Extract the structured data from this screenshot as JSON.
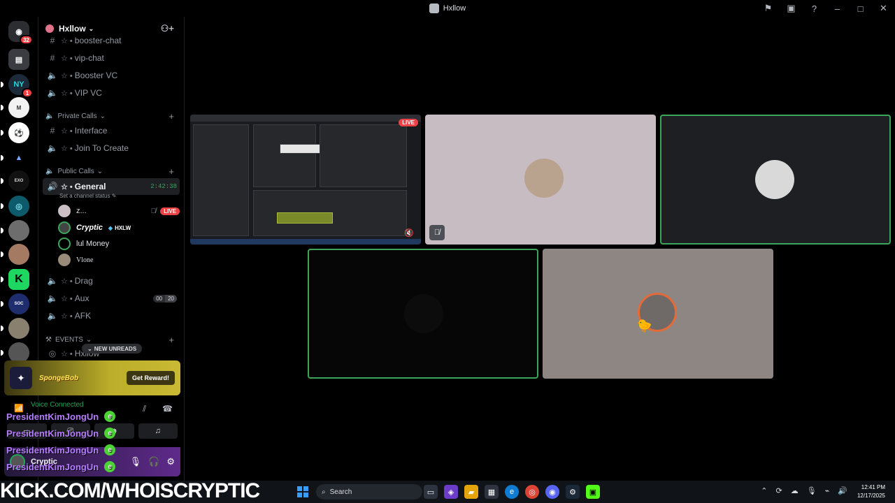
{
  "window": {
    "title": "Hxllow",
    "controls": [
      "inbox-icon",
      "help-icon",
      "minimize",
      "maximize",
      "close"
    ]
  },
  "rail": {
    "badges": {
      "home": "32",
      "ny": "1"
    },
    "servers": [
      "home",
      "archive",
      "ny",
      "money",
      "soccer",
      "arrow",
      "exodus",
      "controller",
      "pfp1",
      "pfp2",
      "kick",
      "social",
      "pfp3",
      "pfp4"
    ]
  },
  "guild": {
    "name": "Hxllow",
    "channels_top": [
      {
        "type": "text",
        "name": "booster-chat"
      },
      {
        "type": "text",
        "name": "vip-chat"
      },
      {
        "type": "voice",
        "name": "Booster VC"
      },
      {
        "type": "voice",
        "name": "VIP VC"
      }
    ],
    "categories": {
      "private": "Private Calls",
      "public": "Public Calls",
      "events": "EVENTS"
    },
    "private_channels": [
      {
        "type": "text",
        "name": "Interface"
      },
      {
        "type": "voice",
        "name": "Join To Create"
      }
    ],
    "active_channel": {
      "name": "General",
      "timer": "2:42:38",
      "status_hint": "Set a channel status"
    },
    "voice_users": [
      {
        "name": "z...",
        "live": "LIVE"
      },
      {
        "name": "Cryptic",
        "tag": "HXLW"
      },
      {
        "name": "lul Money"
      },
      {
        "name": "Vlone"
      }
    ],
    "other_voice": [
      {
        "name": "Drag"
      },
      {
        "name": "Aux",
        "count_a": "00",
        "count_b": "20"
      },
      {
        "name": "AFK"
      }
    ],
    "events_channel": "Hxllow",
    "new_unreads": "NEW UNREADS"
  },
  "promo": {
    "logo": "SpongeBob",
    "button": "Get Reward!"
  },
  "voice_panel": {
    "status": "Voice Connected"
  },
  "user_panel": {
    "name": "Cryptic"
  },
  "chat_overlay": [
    "PresidentKimJongUn",
    "PresidentKimJongUn",
    "PresidentKimJongUn",
    "PresidentKimJongUn"
  ],
  "stage": {
    "live_label": "LIVE"
  },
  "stream_banner": "KICK.COM/WHOISCRYPTIC",
  "taskbar": {
    "search_label": "Search",
    "time": "12:41 PM",
    "date": "12/17/2025"
  },
  "colors": {
    "accent_green": "#3ba55c",
    "live_red": "#ed4245",
    "overlay_purple": "#b57cff"
  }
}
